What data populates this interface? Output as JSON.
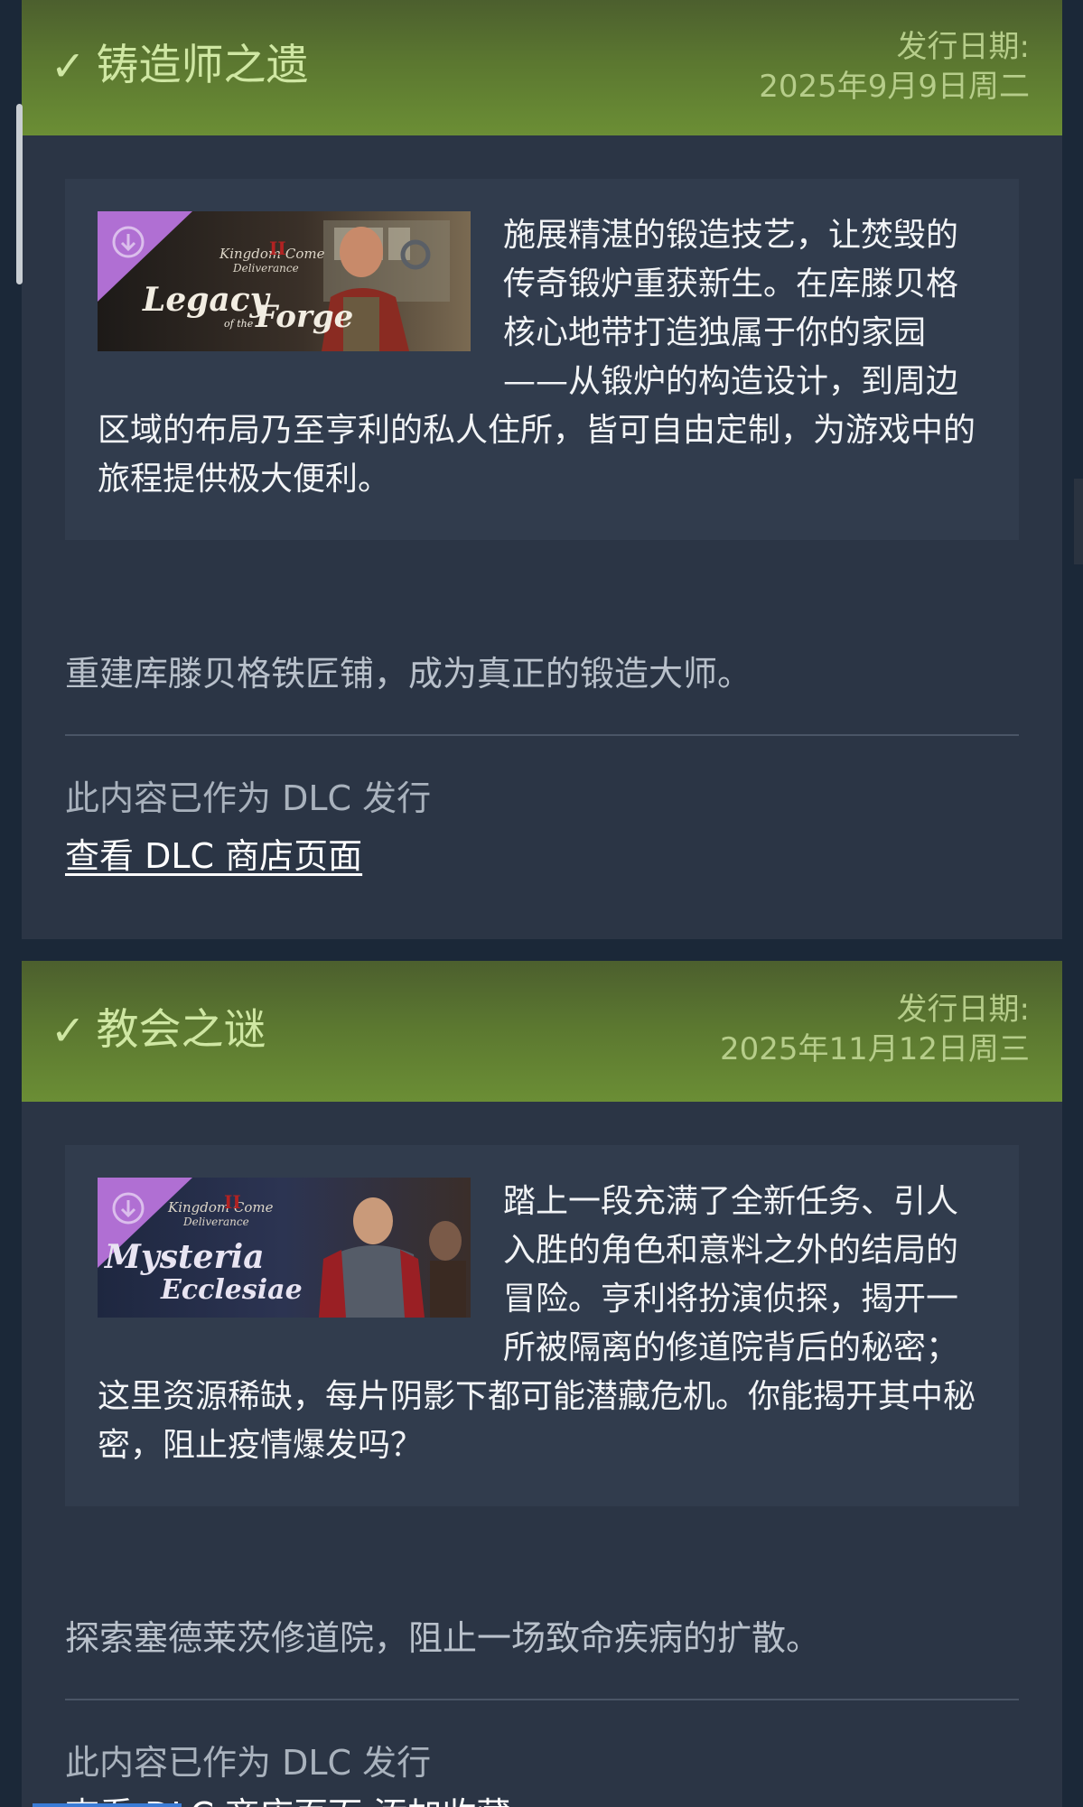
{
  "dlc_list": [
    {
      "title": "铸造师之遗",
      "date_label": "发行日期:",
      "date": "2025年9月9日周二",
      "banner": {
        "logo_line1": "Kingdom Come",
        "logo_line2": "Deliverance",
        "roman": "II",
        "name_line1": "Legacy",
        "name_small": "of the",
        "name_line2": "Forge",
        "accent_color": "#b06fd3"
      },
      "description": "施展精湛的锻造技艺，让焚毁的传奇锻炉重获新生。在库滕贝格核心地带打造独属于你的家园——从锻炉的构造设计，到周边区域的布局乃至亨利的私人住所，皆可自由定制，为游戏中的旅程提供极大便利。",
      "tagline": "重建库滕贝格铁匠铺，成为真正的锻造大师。",
      "released_as": "此内容已作为 DLC 发行",
      "store_link": "查看 DLC 商店页面"
    },
    {
      "title": "教会之谜",
      "date_label": "发行日期:",
      "date": "2025年11月12日周三",
      "banner": {
        "logo_line1": "Kingdom Come",
        "logo_line2": "Deliverance",
        "roman": "II",
        "name_line1": "Mysteria",
        "name_line2": "Ecclesiae",
        "accent_color": "#b06fd3"
      },
      "description": "踏上一段充满了全新任务、引人入胜的角色和意料之外的结局的冒险。亨利将扮演侦探，揭开一所被隔离的修道院背后的秘密；这里资源稀缺，每片阴影下都可能潜藏危机。你能揭开其中秘密，阻止疫情爆发吗？",
      "tagline": "探索塞德莱茨修道院，阻止一场致命疾病的扩散。",
      "released_as": "此内容已作为 DLC 发行",
      "store_link_partial": "查看 DLC 商店页面  添加收藏"
    }
  ]
}
